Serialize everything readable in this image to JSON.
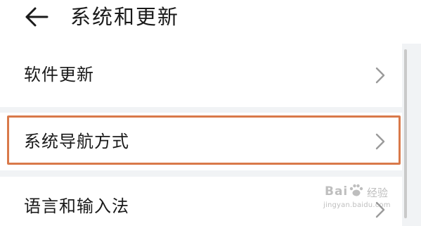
{
  "header": {
    "title": "系统和更新",
    "back_icon": "arrow-left-icon"
  },
  "menu": {
    "items": [
      {
        "label": "软件更新",
        "icon": "chevron-right-icon"
      },
      {
        "label": "系统导航方式",
        "icon": "chevron-right-icon",
        "highlighted": true
      },
      {
        "label": "语言和输入法",
        "icon": "chevron-right-icon"
      }
    ]
  },
  "watermark": {
    "brand": "Bai",
    "brand_suffix": "经验",
    "url": "jingyan.baidu.com"
  },
  "colors": {
    "background": "#f1f3f5",
    "card": "#ffffff",
    "highlight_border": "#d9794a",
    "text": "#1a1a1a",
    "chevron": "#9a9a9a"
  }
}
